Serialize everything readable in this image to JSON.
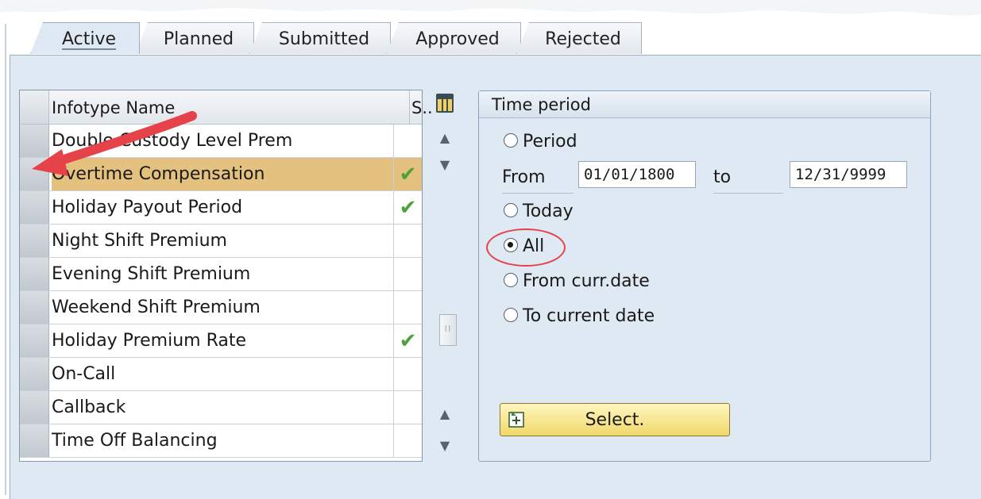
{
  "tabs": [
    {
      "label": "Active"
    },
    {
      "label": "Planned"
    },
    {
      "label": "Submitted"
    },
    {
      "label": "Approved"
    },
    {
      "label": "Rejected"
    }
  ],
  "table": {
    "col_name": "Infotype Name",
    "col_status": "S..",
    "rows": [
      {
        "name": "Double Custody Level Prem",
        "status": ""
      },
      {
        "name": "Overtime Compensation",
        "status": "✔"
      },
      {
        "name": "Holiday Payout Period",
        "status": "✔"
      },
      {
        "name": "Night Shift Premium",
        "status": ""
      },
      {
        "name": "Evening Shift Premium",
        "status": ""
      },
      {
        "name": "Weekend Shift Premium",
        "status": ""
      },
      {
        "name": "Holiday Premium Rate",
        "status": "✔"
      },
      {
        "name": "On-Call",
        "status": ""
      },
      {
        "name": "Callback",
        "status": ""
      },
      {
        "name": "Time Off Balancing",
        "status": ""
      }
    ],
    "selected_row": "Overtime Compensation"
  },
  "time_period": {
    "title": "Time period",
    "period_label": "Period",
    "from_label": "From",
    "from_value": "01/01/1800",
    "to_label": "to",
    "to_value": "12/31/9999",
    "today_label": "Today",
    "all_label": "All",
    "from_curr_label": "From curr.date",
    "to_current_label": "To current date",
    "selected_option": "All",
    "select_button_label": "Select."
  },
  "icons": {
    "status_check": "check-icon",
    "column_config": "column-settings-icon",
    "select_button": "select-icon"
  },
  "colors": {
    "selected_row": "#e4c17f",
    "check": "#4aa23a",
    "annotation": "#e5424a",
    "panel_bg": "#dfe9f3"
  }
}
